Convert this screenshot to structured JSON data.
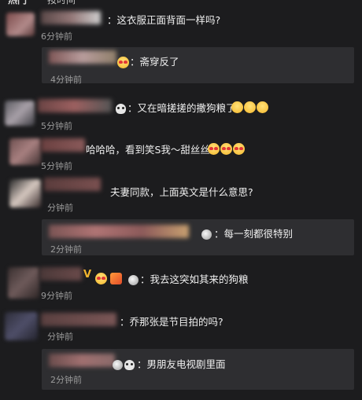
{
  "header": {
    "left_text": "热门",
    "right_text": "按时间"
  },
  "comments": [
    {
      "text": "：这衣服正面背面一样吗?",
      "time": "6分钟前",
      "reply": {
        "text": "：斋穿反了",
        "time": "4分钟前"
      }
    },
    {
      "text": "：又在暗搓搓的撒狗粮了",
      "time": "5分钟前"
    },
    {
      "text": "哈哈哈，看到笑S我～甜丝丝",
      "time": "5分钟前"
    },
    {
      "text": "夫妻同款，上面英文是什么意思?",
      "time": "分钟前",
      "reply": {
        "text": "：每一刻都很特别",
        "time": "2分钟前"
      }
    },
    {
      "text": "：我去这突如其来的狗粮",
      "time": "9分钟前"
    },
    {
      "text": "：乔那张是节目拍的吗?",
      "time": "分钟前",
      "reply": {
        "text": "：男朋友电视剧里面",
        "time": "2分钟前"
      }
    }
  ],
  "badges": {
    "vip_letter": "V"
  },
  "colors": {
    "background": "#1c1c1e",
    "reply_bg": "#2e2e31",
    "time": "#9a9a9a"
  }
}
